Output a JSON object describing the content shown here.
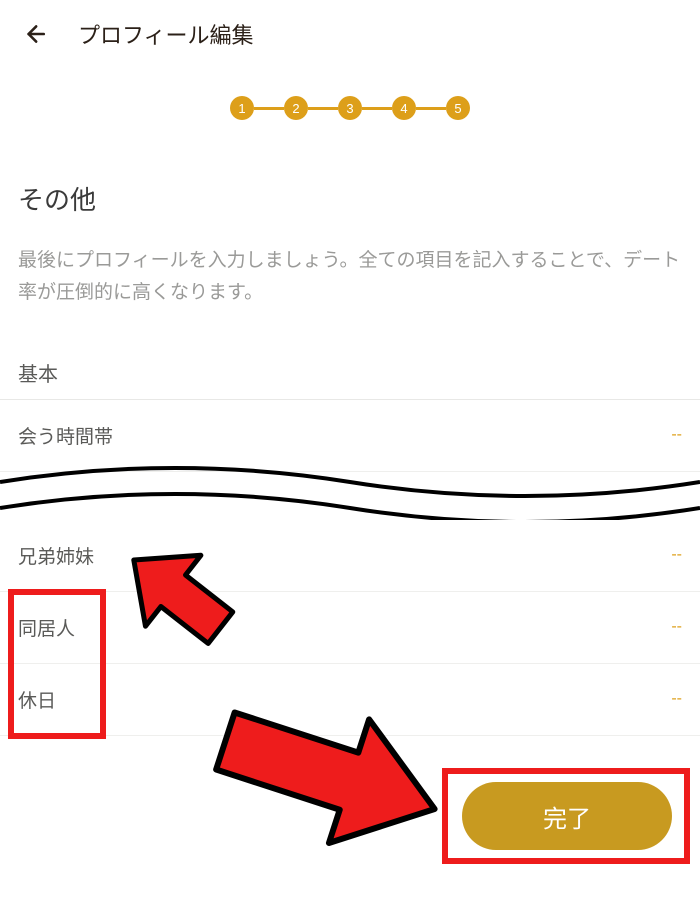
{
  "header": {
    "title": "プロフィール編集"
  },
  "stepper": {
    "steps": [
      "1",
      "2",
      "3",
      "4",
      "5"
    ]
  },
  "section": {
    "title": "その他",
    "desc": "最後にプロフィールを入力しましょう。全ての項目を記入することで、デート率が圧倒的に高くなります。",
    "subtitle": "基本"
  },
  "rows": {
    "meeting_time": {
      "label": "会う時間帯",
      "value": "--"
    },
    "siblings": {
      "label": "兄弟姉妹",
      "value": "--"
    },
    "housemate": {
      "label": "同居人",
      "value": "--"
    },
    "dayoff": {
      "label": "休日",
      "value": "--"
    }
  },
  "button": {
    "complete": "完了"
  },
  "colors": {
    "accent": "#dd9f1a",
    "btn": "#c89a20",
    "highlight": "#ee1c1c"
  }
}
